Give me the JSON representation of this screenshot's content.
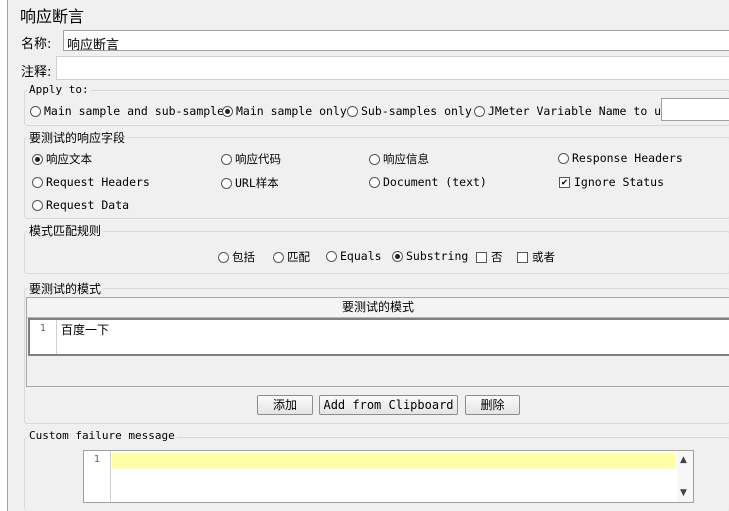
{
  "panel": {
    "title": "响应断言"
  },
  "name_row": {
    "label": "名称:",
    "value": "响应断言"
  },
  "comment_row": {
    "label": "注释:",
    "value": ""
  },
  "apply_to": {
    "legend": "Apply to:",
    "options": [
      "Main sample and sub-samples",
      "Main sample only",
      "Sub-samples only",
      "JMeter Variable Name to use"
    ],
    "selected": "Main sample only",
    "variable_value": ""
  },
  "response_field": {
    "legend": "要测试的响应字段",
    "options": [
      "响应文本",
      "响应代码",
      "响应信息",
      "Response Headers",
      "Request Headers",
      "URL样本",
      "Document (text)",
      "Request Data"
    ],
    "selected": "响应文本",
    "ignore_status_label": "Ignore Status",
    "ignore_status_checked": true
  },
  "pattern_rules": {
    "legend": "模式匹配规则",
    "options": [
      "包括",
      "匹配",
      "Equals",
      "Substring"
    ],
    "selected": "Substring",
    "not_label": "否",
    "not_checked": false,
    "or_label": "或者",
    "or_checked": false
  },
  "patterns": {
    "legend": "要测试的模式",
    "column_header": "要测试的模式",
    "rows": [
      {
        "line": "1",
        "text": "百度一下"
      }
    ],
    "add_label": "添加",
    "clipboard_label": "Add from Clipboard",
    "delete_label": "删除"
  },
  "failure": {
    "legend": "Custom failure message",
    "line": "1",
    "value": "",
    "highlight_color": "#ffffaa"
  }
}
